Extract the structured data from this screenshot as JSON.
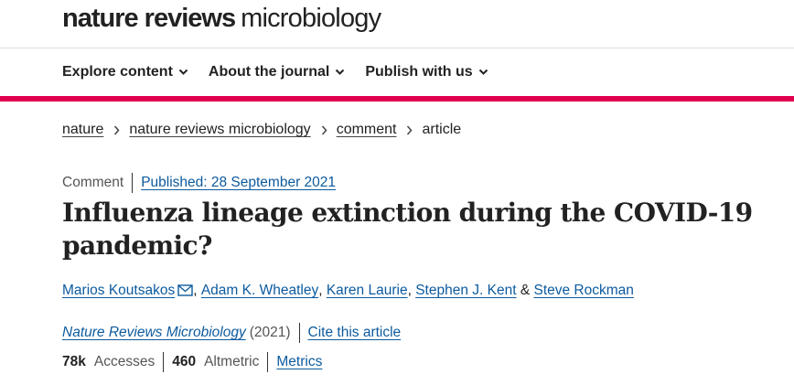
{
  "header": {
    "brand_bold": "nature reviews",
    "brand_light": "microbiology"
  },
  "nav": {
    "items": [
      {
        "label": "Explore content"
      },
      {
        "label": "About the journal"
      },
      {
        "label": "Publish with us"
      }
    ],
    "icon": "chevron-down-icon"
  },
  "colors": {
    "accent": "#e0004d",
    "link": "#0c5a9e",
    "text": "#222222"
  },
  "breadcrumb": {
    "items": [
      {
        "label": "nature",
        "link": true
      },
      {
        "label": "nature reviews microbiology",
        "link": true
      },
      {
        "label": "comment",
        "link": true
      },
      {
        "label": "article",
        "link": false
      }
    ],
    "separator_icon": "chevron-right-icon"
  },
  "article": {
    "type": "Comment",
    "published": "Published: 28 September 2021",
    "title": "Influenza lineage extinction during the COVID-19 pandemic?",
    "authors": [
      "Marios Koutsakos",
      "Adam K. Wheatley",
      "Karen Laurie",
      "Stephen J. Kent",
      "Steve Rockman"
    ],
    "author_separator": ",",
    "author_final_joiner": "&",
    "corresponding_icon": "mail-icon",
    "journal": "Nature Reviews Microbiology",
    "year": "(2021)",
    "cite_label": "Cite this article",
    "accesses_value": "78k",
    "accesses_label": "Accesses",
    "altmetric_value": "460",
    "altmetric_label": "Altmetric",
    "metrics_label": "Metrics"
  }
}
